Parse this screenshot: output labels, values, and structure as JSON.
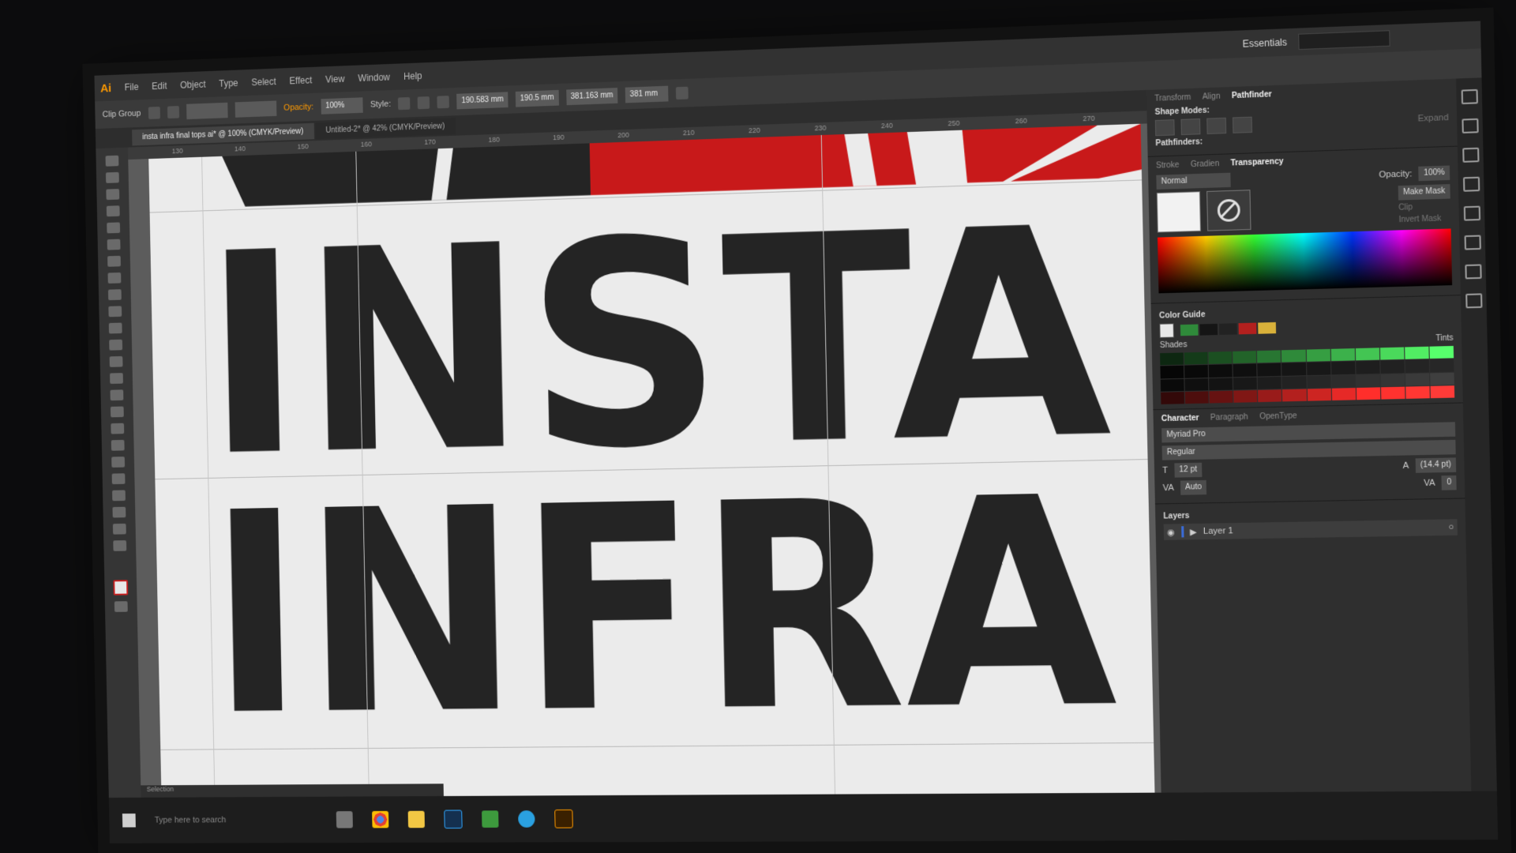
{
  "app": {
    "logo": "Ai",
    "workspace": "Essentials"
  },
  "menu": [
    "File",
    "Edit",
    "Object",
    "Type",
    "Select",
    "Effect",
    "View",
    "Window",
    "Help"
  ],
  "controlbar": {
    "left_label": "Clip Group",
    "opacity_label": "Opacity:",
    "opacity_value": "100%",
    "style_label": "Style:",
    "x_value": "190.583 mm",
    "y_value": "190.5 mm",
    "w_value": "381.163 mm",
    "h_value": "381 mm"
  },
  "tabs": [
    {
      "label": "insta infra final tops ai* @ 100% (CMYK/Preview)",
      "active": true
    },
    {
      "label": "Untitled-2* @ 42% (CMYK/Preview)",
      "active": false
    }
  ],
  "ruler_ticks": [
    "130",
    "140",
    "150",
    "160",
    "170",
    "180",
    "190",
    "200",
    "210",
    "220",
    "230",
    "240",
    "250",
    "260",
    "270"
  ],
  "artwork": {
    "line1": "INSTA",
    "line2": "INFRA",
    "accent_color": "#c8191a",
    "text_color": "#242424"
  },
  "panels": {
    "pathfinder": {
      "tabs": [
        "Transform",
        "Align",
        "Pathfinder"
      ],
      "shape_modes_label": "Shape Modes:",
      "pathfinders_label": "Pathfinders:",
      "expand_label": "Expand"
    },
    "transparency": {
      "tabs": [
        "Stroke",
        "Gradien",
        "Transparency"
      ],
      "blend_mode": "Normal",
      "opacity_label": "Opacity:",
      "opacity_value": "100%",
      "make_mask": "Make Mask",
      "clip": "Clip",
      "invert_mask": "Invert Mask"
    },
    "color_guide": {
      "title": "Color Guide",
      "shades_label": "Shades",
      "tints_label": "Tints",
      "harmony": [
        "#2f8a3a",
        "#151515",
        "#222222",
        "#b3201e",
        "#d9b13a"
      ]
    },
    "character": {
      "tabs": [
        "Character",
        "Paragraph",
        "OpenType"
      ],
      "font": "Myriad Pro",
      "style": "Regular",
      "size": "12 pt",
      "leading": "(14.4 pt)",
      "kerning": "Auto",
      "tracking": "0"
    },
    "layers": {
      "title": "Layers",
      "layer_name": "Layer 1"
    }
  },
  "taskbar": {
    "search_placeholder": "Type here to search",
    "apps": [
      "task-view-icon",
      "chrome-icon",
      "file-explorer-icon",
      "photoshop-icon",
      "app-icon",
      "browser-icon",
      "illustrator-icon"
    ]
  },
  "status": {
    "tool": "Selection"
  }
}
